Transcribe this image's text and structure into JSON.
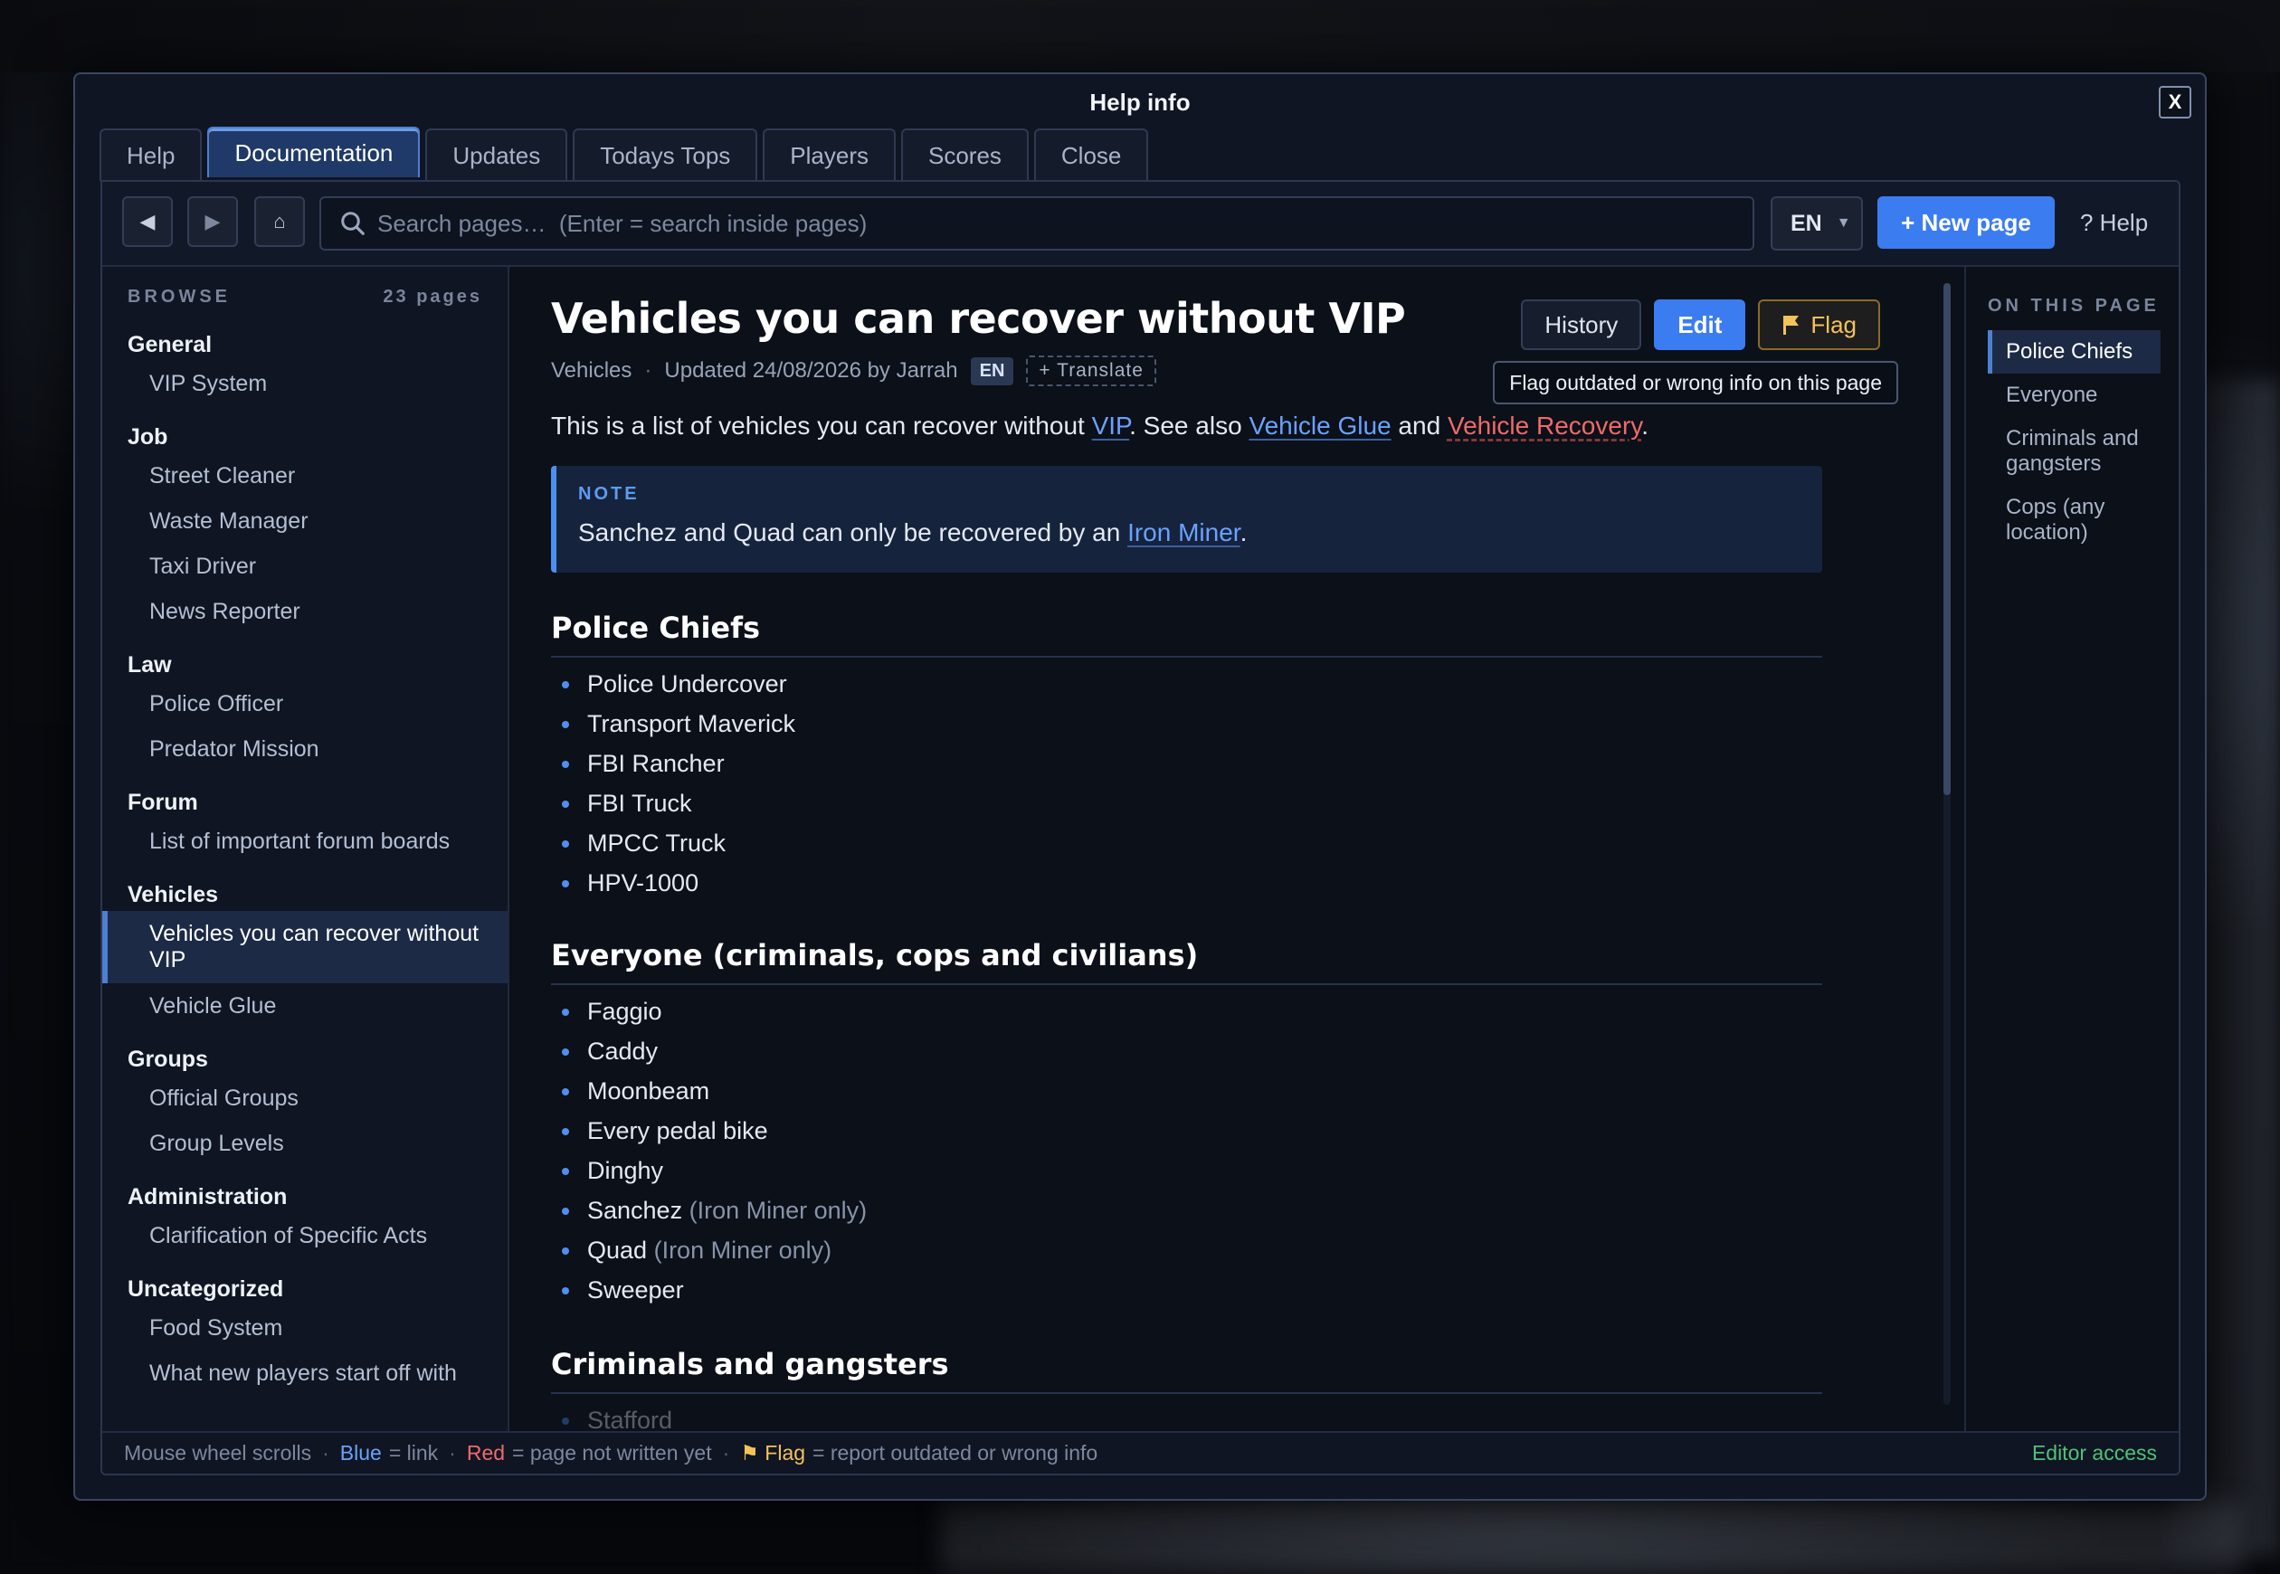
{
  "window": {
    "title": "Help info",
    "close_label": "X"
  },
  "tabs": [
    {
      "label": "Help",
      "active": false
    },
    {
      "label": "Documentation",
      "active": true
    },
    {
      "label": "Updates",
      "active": false
    },
    {
      "label": "Todays Tops",
      "active": false
    },
    {
      "label": "Players",
      "active": false
    },
    {
      "label": "Scores",
      "active": false
    },
    {
      "label": "Close",
      "active": false
    }
  ],
  "toolbar": {
    "back_icon": "back-arrow-icon",
    "forward_icon": "forward-arrow-icon",
    "home_icon": "home-icon",
    "search_placeholder": "Search pages…  (Enter = search inside pages)",
    "language": "EN",
    "new_page_label": "+ New page",
    "help_label": "? Help"
  },
  "sidebar": {
    "header": "BROWSE",
    "count": "23 pages",
    "groups": [
      {
        "title": "General",
        "items": [
          "VIP System"
        ]
      },
      {
        "title": "Job",
        "items": [
          "Street Cleaner",
          "Waste Manager",
          "Taxi Driver",
          "News Reporter"
        ]
      },
      {
        "title": "Law",
        "items": [
          "Police Officer",
          "Predator Mission"
        ]
      },
      {
        "title": "Forum",
        "items": [
          "List of important forum boards"
        ]
      },
      {
        "title": "Vehicles",
        "items": [
          "Vehicles you can recover without VIP",
          "Vehicle Glue"
        ]
      },
      {
        "title": "Groups",
        "items": [
          "Official Groups",
          "Group Levels"
        ]
      },
      {
        "title": "Administration",
        "items": [
          "Clarification of Specific Acts"
        ]
      },
      {
        "title": "Uncategorized",
        "items": [
          "Food System",
          "What new players start off with"
        ]
      }
    ],
    "active_item": "Vehicles you can recover without VIP"
  },
  "page": {
    "title": "Vehicles you can recover without VIP",
    "category": "Vehicles",
    "updated": "Updated 24/08/2026 by Jarrah",
    "lang_badge": "EN",
    "translate_label": "+ Translate",
    "history_label": "History",
    "edit_label": "Edit",
    "flag_label": "Flag",
    "flag_tooltip": "Flag outdated or wrong info on this page",
    "intro": {
      "before": "This is a list of vehicles you can recover without ",
      "vip": "VIP",
      "middle": ". See also ",
      "glue": "Vehicle Glue",
      "and": " and ",
      "recovery": "Vehicle Recovery",
      "end": "."
    },
    "note": {
      "label": "NOTE",
      "before": "Sanchez and Quad can only be recovered by an ",
      "link": "Iron Miner",
      "end": "."
    },
    "sections": [
      {
        "heading": "Police Chiefs",
        "items": [
          {
            "name": "Police Undercover",
            "sub": ""
          },
          {
            "name": "Transport Maverick",
            "sub": ""
          },
          {
            "name": "FBI Rancher",
            "sub": ""
          },
          {
            "name": "FBI Truck",
            "sub": ""
          },
          {
            "name": "MPCC Truck",
            "sub": ""
          },
          {
            "name": "HPV-1000",
            "sub": ""
          }
        ]
      },
      {
        "heading": "Everyone (criminals, cops and civilians)",
        "items": [
          {
            "name": "Faggio",
            "sub": ""
          },
          {
            "name": "Caddy",
            "sub": ""
          },
          {
            "name": "Moonbeam",
            "sub": ""
          },
          {
            "name": "Every pedal bike",
            "sub": ""
          },
          {
            "name": "Dinghy",
            "sub": ""
          },
          {
            "name": "Sanchez",
            "sub": "(Iron Miner only)"
          },
          {
            "name": "Quad",
            "sub": "(Iron Miner only)"
          },
          {
            "name": "Sweeper",
            "sub": ""
          }
        ]
      },
      {
        "heading": "Criminals and gangsters",
        "items": [
          {
            "name": "Stafford",
            "sub": ""
          }
        ]
      }
    ]
  },
  "toc": {
    "header": "ON THIS PAGE",
    "items": [
      "Police Chiefs",
      "Everyone",
      "Criminals and gangsters",
      "Cops (any location)"
    ],
    "active": "Police Chiefs"
  },
  "statusbar": {
    "scroll_hint": "Mouse wheel scrolls",
    "blue_word": "Blue",
    "blue_desc": "= link",
    "red_word": "Red",
    "red_desc": "= page not written yet",
    "flag_word": "Flag",
    "flag_desc": "= report outdated or wrong info",
    "editor": "Editor access"
  },
  "colors": {
    "accent": "#3b7cf0",
    "link": "#6aa2ff",
    "missing": "#f06a6a",
    "flag": "#f3c35a",
    "editor": "#4fc27a"
  }
}
